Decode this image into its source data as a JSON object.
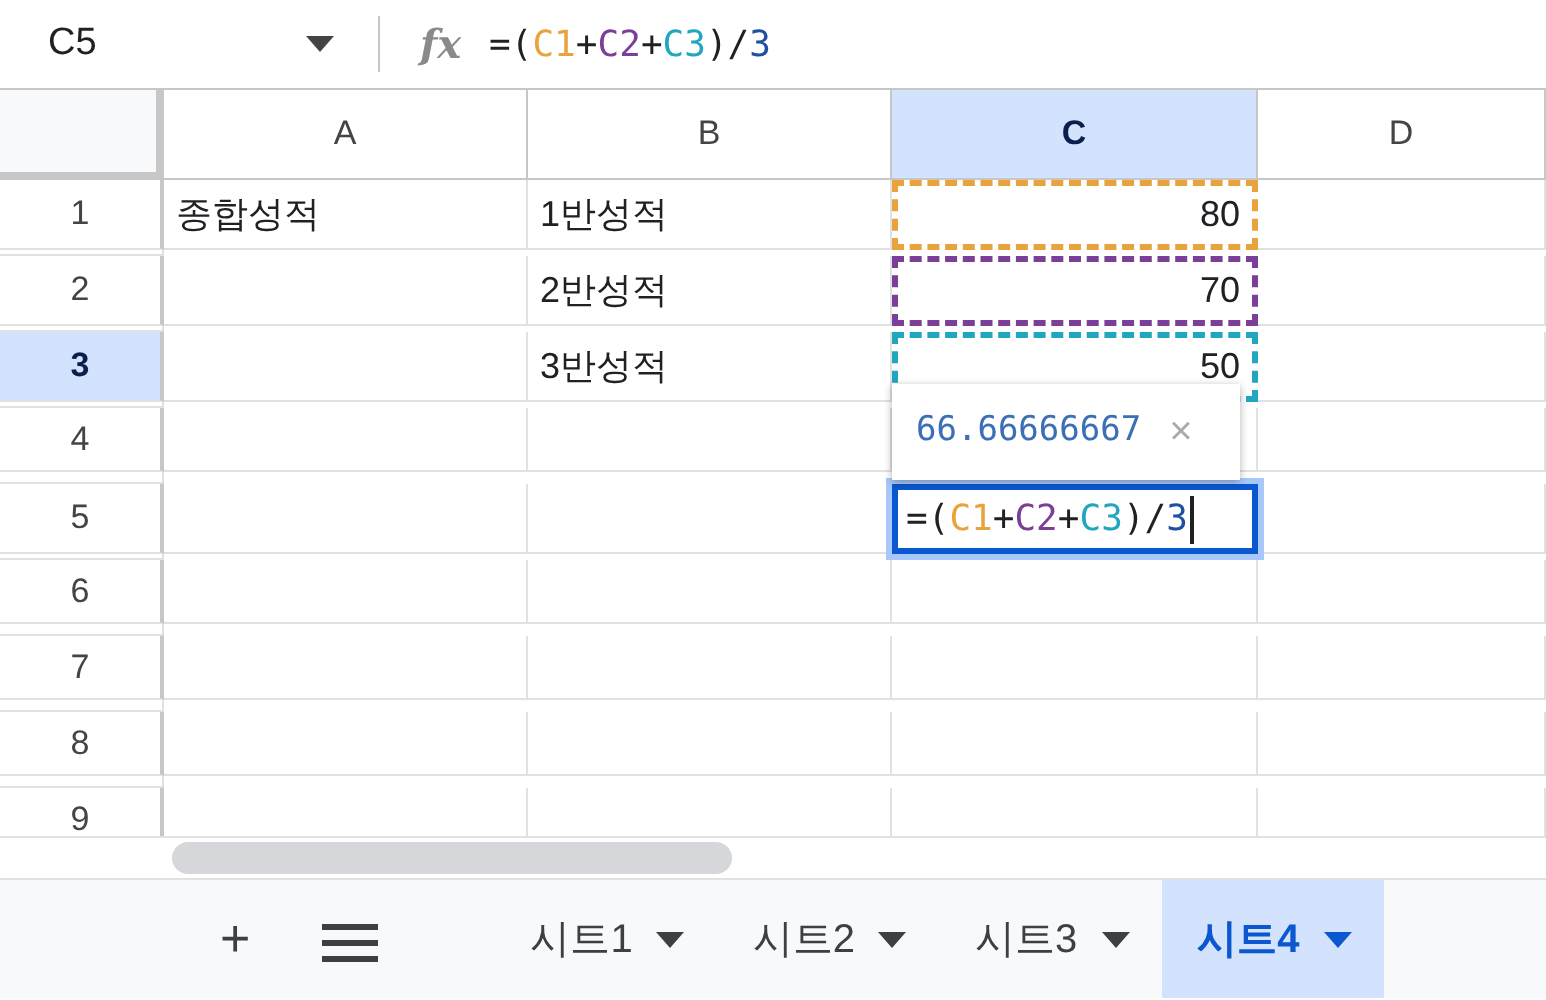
{
  "name_box": {
    "value": "C5"
  },
  "formula_bar": {
    "label": "fx",
    "tokens": [
      {
        "text": "=(",
        "color": "#202124"
      },
      {
        "text": "C1",
        "color": "#e8a33d"
      },
      {
        "text": "+",
        "color": "#202124"
      },
      {
        "text": "C2",
        "color": "#7b3f99"
      },
      {
        "text": "+",
        "color": "#202124"
      },
      {
        "text": "C3",
        "color": "#20a7bf"
      },
      {
        "text": ")/",
        "color": "#202124"
      },
      {
        "text": "3",
        "color": "#1f4fa3"
      }
    ]
  },
  "columns": [
    {
      "label": "A",
      "selected": false
    },
    {
      "label": "B",
      "selected": false
    },
    {
      "label": "C",
      "selected": true
    },
    {
      "label": "D",
      "selected": false
    }
  ],
  "rows": [
    {
      "header": "1",
      "selected": false,
      "cells": [
        {
          "value": "종합성적"
        },
        {
          "value": "1반성적"
        },
        {
          "value": "80",
          "color": "#e8a33d"
        },
        {}
      ]
    },
    {
      "header": "2",
      "selected": false,
      "cells": [
        {},
        {
          "value": "2반성적"
        },
        {
          "value": "70",
          "color": "#7b3f99"
        },
        {}
      ]
    },
    {
      "header": "3",
      "selected": true,
      "cells": [
        {},
        {
          "value": "3반성적"
        },
        {
          "value": "50",
          "color": "#20a7bf"
        },
        {}
      ]
    },
    {
      "header": "4",
      "selected": false,
      "cells": [
        {},
        {},
        {},
        {}
      ]
    },
    {
      "header": "5",
      "selected": false,
      "cells": [
        {},
        {},
        {
          "formula_tokens": [
            {
              "text": "=(",
              "color": "#202124"
            },
            {
              "text": "C1",
              "color": "#e8a33d"
            },
            {
              "text": "+",
              "color": "#202124"
            },
            {
              "text": "C2",
              "color": "#7b3f99"
            },
            {
              "text": "+",
              "color": "#202124"
            },
            {
              "text": "C3",
              "color": "#20a7bf"
            },
            {
              "text": ")/",
              "color": "#202124"
            },
            {
              "text": "3",
              "color": "#1f4fa3"
            }
          ]
        },
        {}
      ]
    },
    {
      "header": "6",
      "selected": false,
      "cells": [
        {},
        {},
        {},
        {}
      ]
    },
    {
      "header": "7",
      "selected": false,
      "cells": [
        {},
        {},
        {},
        {}
      ]
    },
    {
      "header": "8",
      "selected": false,
      "cells": [
        {},
        {},
        {},
        {}
      ]
    },
    {
      "header": "9",
      "selected": false,
      "cells": [
        {},
        {},
        {},
        {}
      ]
    }
  ],
  "result_tooltip": {
    "value": "66.66666667",
    "close": "×"
  },
  "sheet_tabs": [
    {
      "label": "시트1",
      "selected": false
    },
    {
      "label": "시트2",
      "selected": false
    },
    {
      "label": "시트3",
      "selected": false
    },
    {
      "label": "시트4",
      "selected": true
    }
  ],
  "tab_buttons": {
    "add": "+"
  }
}
